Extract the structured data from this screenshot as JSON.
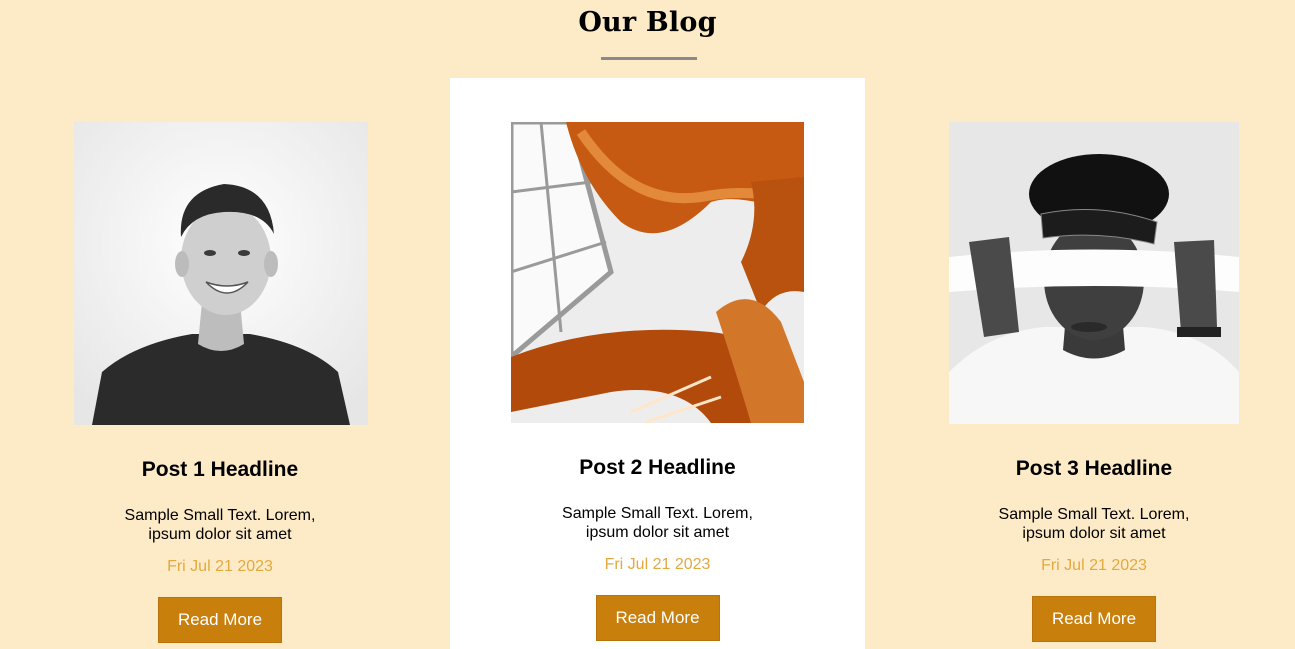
{
  "blog": {
    "title": "Our Blog"
  },
  "colors": {
    "background": "#fdebc7",
    "featured_card": "#ffffff",
    "button": "#c97f0c",
    "date_text": "#e3a93f",
    "underline": "#8a8a8a"
  },
  "posts": [
    {
      "image_icon": "portrait-smiling-man-photo",
      "headline": "Post 1 Headline",
      "summary": "Sample Small Text. Lorem, ipsum dolor sit amet",
      "date": "Fri Jul 21 2023",
      "button_label": "Read More"
    },
    {
      "image_icon": "spiral-staircase-photo",
      "headline": "Post 2 Headline",
      "summary": "Sample Small Text. Lorem, ipsum dolor sit amet",
      "date": "Fri Jul 21 2023",
      "button_label": "Read More"
    },
    {
      "image_icon": "blindfolded-man-photo",
      "headline": "Post 3 Headline",
      "summary": "Sample Small Text. Lorem, ipsum dolor sit amet",
      "date": "Fri Jul 21 2023",
      "button_label": "Read More"
    }
  ]
}
